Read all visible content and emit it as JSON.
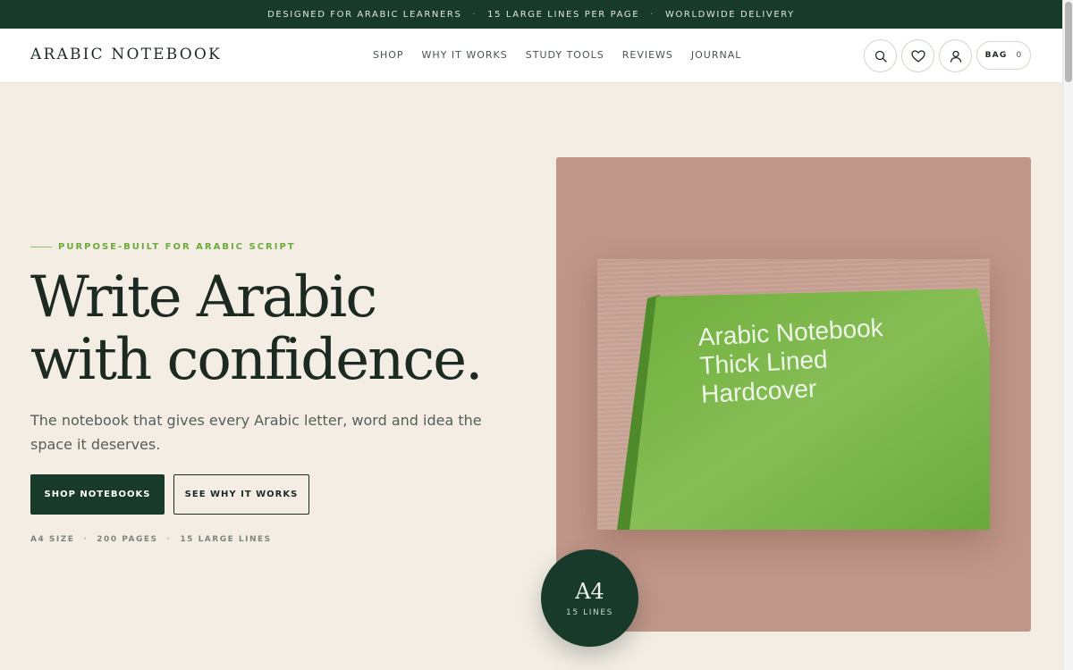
{
  "announcement": {
    "items": [
      "DESIGNED FOR ARABIC LEARNERS",
      "15 LARGE LINES PER PAGE",
      "WORLDWIDE DELIVERY"
    ],
    "separator": "·"
  },
  "header": {
    "logo": "ARABIC NOTEBOOK",
    "nav": [
      "SHOP",
      "WHY IT WORKS",
      "STUDY TOOLS",
      "REVIEWS",
      "JOURNAL"
    ],
    "bag_label": "BAG",
    "bag_count": "0",
    "icons": [
      "search-icon",
      "heart-icon",
      "user-icon"
    ]
  },
  "hero": {
    "eyebrow": "PURPOSE-BUILT FOR ARABIC SCRIPT",
    "headline_line1": "Write Arabic",
    "headline_line2": "with confidence.",
    "subheading": "The notebook that gives every Arabic letter, word and idea the space it deserves.",
    "primary_cta": "SHOP NOTEBOOKS",
    "secondary_cta": "SEE WHY IT WORKS",
    "specs": [
      "A4 SIZE",
      "200 PAGES",
      "15 LARGE LINES"
    ],
    "spec_separator": "·"
  },
  "product": {
    "cover_text": "Arabic Notebook\nThick Lined\nHardcover",
    "badge_big": "A4",
    "badge_small": "15 LINES"
  },
  "colors": {
    "brand_dark": "#173a2a",
    "accent_green": "#6aab3a",
    "background": "#f3ede4",
    "panel": "#c09688",
    "notebook": "#79b548"
  }
}
